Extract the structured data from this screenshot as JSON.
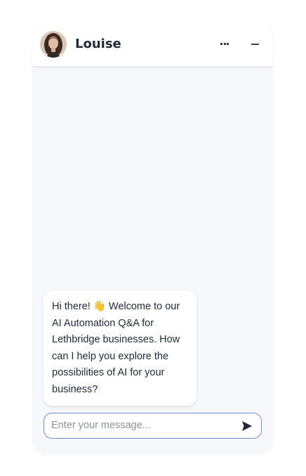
{
  "agent": {
    "name": "Louise",
    "avatar_icon": "avatar-photo"
  },
  "header": {
    "more_icon": "more-dots-icon",
    "minimize_icon": "minimize-icon"
  },
  "messages": [
    {
      "sender": "agent",
      "text": "Hi there! 👋 Welcome to our AI Automation Q&A for Lethbridge businesses. How can I help you explore the possibilities of AI for your business?"
    }
  ],
  "composer": {
    "placeholder": "Enter your message...",
    "value": "",
    "send_icon": "send-icon"
  },
  "colors": {
    "panel_bg": "#f6f8fb",
    "input_border": "#6b8fcf",
    "text": "#1f2937"
  }
}
